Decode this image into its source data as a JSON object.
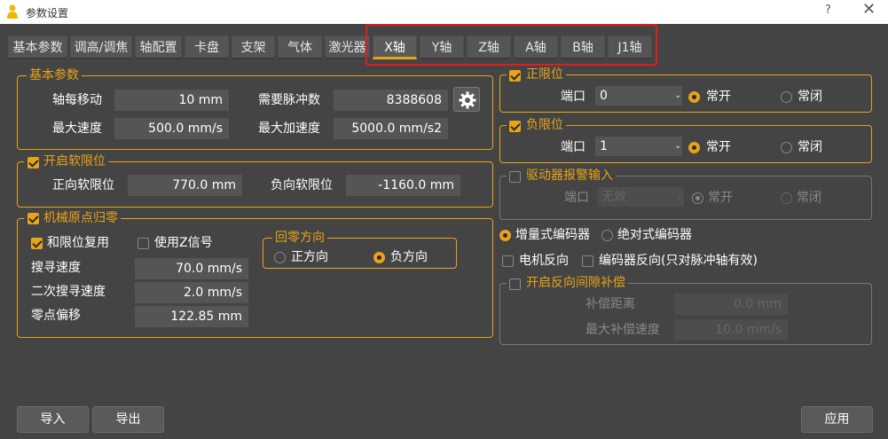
{
  "window": {
    "title": "参数设置",
    "help": "?",
    "close": "✕"
  },
  "tabs": [
    "基本参数",
    "调高/调焦",
    "轴配置",
    "卡盘",
    "支架",
    "气体",
    "激光器",
    "X轴",
    "Y轴",
    "Z轴",
    "A轴",
    "B轴",
    "J1轴"
  ],
  "active_tab": "X轴",
  "basic": {
    "legend": "基本参数",
    "move_per_rev_label": "轴每移动",
    "move_per_rev_value": "10 mm",
    "pulses_label": "需要脉冲数",
    "pulses_value": "8388608",
    "max_speed_label": "最大速度",
    "max_speed_value": "500.0 mm/s",
    "max_accel_label": "最大加速度",
    "max_accel_value": "5000.0 mm/s2"
  },
  "soft_limit": {
    "legend": "开启软限位",
    "enabled": true,
    "pos_label": "正向软限位",
    "pos_value": "770.0 mm",
    "neg_label": "负向软限位",
    "neg_value": "-1160.0 mm"
  },
  "homing": {
    "legend": "机械原点归零",
    "reuse_limit_label": "和限位复用",
    "reuse_limit": true,
    "use_z_label": "使用Z信号",
    "use_z": false,
    "search_speed_label": "搜寻速度",
    "search_speed_value": "70.0 mm/s",
    "second_speed_label": "二次搜寻速度",
    "second_speed_value": "2.0 mm/s",
    "offset_label": "零点偏移",
    "offset_value": "122.85 mm",
    "direction": {
      "legend": "回零方向",
      "positive": "正方向",
      "negative": "负方向",
      "selected": "负方向"
    }
  },
  "pos_limit": {
    "legend": "正限位",
    "enabled": true,
    "port_label": "端口",
    "port_value": "0",
    "no": "常开",
    "nc": "常闭",
    "selected": "常开"
  },
  "neg_limit": {
    "legend": "负限位",
    "enabled": true,
    "port_label": "端口",
    "port_value": "1",
    "no": "常开",
    "nc": "常闭",
    "selected": "常开"
  },
  "driver_alarm": {
    "legend": "驱动器报警输入",
    "enabled": false,
    "port_label": "端口",
    "port_value": "无效",
    "no": "常开",
    "nc": "常闭",
    "selected": "常开"
  },
  "encoder": {
    "incremental": "增量式编码器",
    "absolute": "绝对式编码器",
    "selected": "增量式编码器",
    "motor_reverse": "电机反向",
    "encoder_reverse": "编码器反向(只对脉冲轴有效)"
  },
  "backlash": {
    "legend": "开启反向间隙补偿",
    "enabled": false,
    "distance_label": "补偿距离",
    "distance_value": "0.0 mm",
    "speed_label": "最大补偿速度",
    "speed_value": "10.0 mm/s"
  },
  "buttons": {
    "import": "导入",
    "export": "导出",
    "apply": "应用"
  },
  "colors": {
    "accent": "#e8a317",
    "background": "#444444",
    "highlight": "#e21d1d"
  }
}
